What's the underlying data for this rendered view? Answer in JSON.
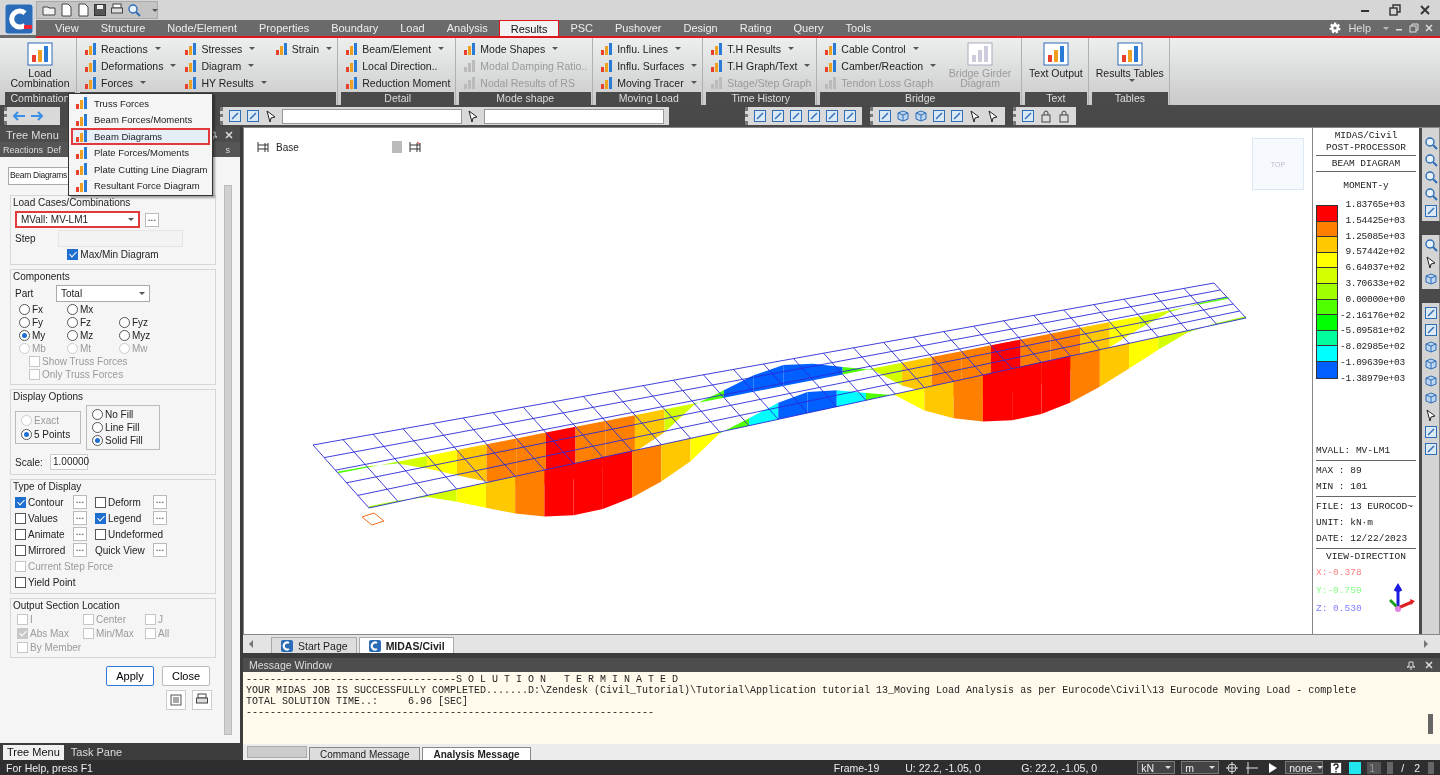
{
  "ribbon": {
    "tabs": [
      {
        "label": "View",
        "selected": false
      },
      {
        "label": "Structure",
        "selected": false
      },
      {
        "label": "Node/Element",
        "selected": false
      },
      {
        "label": "Properties",
        "selected": false
      },
      {
        "label": "Boundary",
        "selected": false
      },
      {
        "label": "Load",
        "selected": false
      },
      {
        "label": "Analysis",
        "selected": false
      },
      {
        "label": "Results",
        "selected": true
      },
      {
        "label": "PSC",
        "selected": false
      },
      {
        "label": "Pushover",
        "selected": false
      },
      {
        "label": "Design",
        "selected": false
      },
      {
        "label": "Rating",
        "selected": false
      },
      {
        "label": "Query",
        "selected": false
      },
      {
        "label": "Tools",
        "selected": false
      }
    ],
    "help": "Help",
    "groups": [
      {
        "label": "Combination",
        "columns": [
          [
            {
              "kind": "large",
              "label": "Load Combination",
              "disabled": false,
              "dropdown": false
            }
          ]
        ]
      },
      {
        "columns": [
          [
            {
              "kind": "small",
              "label": "Reactions",
              "disabled": false,
              "dropdown": true
            },
            {
              "kind": "small",
              "label": "Deformations",
              "disabled": false,
              "dropdown": true
            },
            {
              "kind": "small",
              "label": "Forces",
              "disabled": false,
              "dropdown": true
            }
          ],
          [
            {
              "kind": "small",
              "label": "Stresses",
              "disabled": false,
              "dropdown": true
            },
            {
              "kind": "small",
              "label": "Diagram",
              "disabled": false,
              "dropdown": true
            },
            {
              "kind": "small",
              "label": "HY Results",
              "disabled": false,
              "dropdown": true
            }
          ],
          [
            {
              "kind": "small",
              "label": "Strain",
              "disabled": false,
              "dropdown": true
            }
          ]
        ]
      },
      {
        "label": "Detail",
        "columns": [
          [
            {
              "kind": "small",
              "label": "Beam/Element",
              "disabled": false,
              "dropdown": true
            },
            {
              "kind": "small",
              "label": "Local Direction..",
              "disabled": false,
              "dropdown": false
            },
            {
              "kind": "small",
              "label": "Reduction Moment",
              "disabled": false,
              "dropdown": false
            }
          ]
        ]
      },
      {
        "label": "Mode shape",
        "columns": [
          [
            {
              "kind": "small",
              "label": "Mode Shapes",
              "disabled": false,
              "dropdown": true
            },
            {
              "kind": "small",
              "label": "Modal Damping Ratio..",
              "disabled": true,
              "dropdown": false
            },
            {
              "kind": "small",
              "label": "Nodal Results of RS",
              "disabled": true,
              "dropdown": false
            }
          ]
        ]
      },
      {
        "label": "Moving Load",
        "columns": [
          [
            {
              "kind": "small",
              "label": "Influ. Lines",
              "disabled": false,
              "dropdown": true
            },
            {
              "kind": "small",
              "label": "Influ. Surfaces",
              "disabled": false,
              "dropdown": true
            },
            {
              "kind": "small",
              "label": "Moving Tracer",
              "disabled": false,
              "dropdown": true
            }
          ]
        ]
      },
      {
        "label": "Time History",
        "columns": [
          [
            {
              "kind": "small",
              "label": "T.H Results",
              "disabled": false,
              "dropdown": true
            },
            {
              "kind": "small",
              "label": "T.H Graph/Text",
              "disabled": false,
              "dropdown": true
            },
            {
              "kind": "small",
              "label": "Stage/Step Graph",
              "disabled": true,
              "dropdown": false
            }
          ]
        ]
      },
      {
        "label": "Bridge",
        "columns": [
          [
            {
              "kind": "small",
              "label": "Cable Control",
              "disabled": false,
              "dropdown": true
            },
            {
              "kind": "small",
              "label": "Camber/Reaction",
              "disabled": false,
              "dropdown": true
            },
            {
              "kind": "small",
              "label": "Tendon Loss Graph",
              "disabled": true,
              "dropdown": false
            }
          ],
          [
            {
              "kind": "large",
              "label": "Bridge Girder Diagram",
              "disabled": true,
              "dropdown": false
            }
          ]
        ]
      },
      {
        "label": "Text",
        "columns": [
          [
            {
              "kind": "large",
              "label": "Text Output",
              "disabled": false,
              "dropdown": false
            }
          ]
        ]
      },
      {
        "label": "Tables",
        "columns": [
          [
            {
              "kind": "large",
              "label": "Results Tables",
              "disabled": false,
              "dropdown": true
            }
          ]
        ]
      }
    ]
  },
  "forces_menu": [
    {
      "label": "Truss Forces",
      "selected": false
    },
    {
      "label": "Beam Forces/Moments",
      "selected": false
    },
    {
      "label": "Beam Diagrams",
      "selected": true
    },
    {
      "label": "Plate Forces/Moments",
      "selected": false
    },
    {
      "label": "Plate Cutting Line Diagram",
      "selected": false
    },
    {
      "label": "Resultant Force Diagram",
      "selected": false
    }
  ],
  "panel": {
    "title": "Tree Menu",
    "tabs": [
      "Reactions",
      "Def",
      "s"
    ],
    "function_field": "Beam Diagrams",
    "load_cases": {
      "title": "Load Cases/Combinations",
      "value": "MVall: MV-LM1",
      "more": "...",
      "step_label": "Step",
      "maxmin": {
        "label": "Max/Min Diagram",
        "checked": true
      }
    },
    "components": {
      "title": "Components",
      "part_label": "Part",
      "part_value": "Total",
      "radio_rows": [
        [
          {
            "label": "Fx",
            "selected": false,
            "disabled": false
          },
          {
            "label": "Mx",
            "selected": false,
            "disabled": false
          }
        ],
        [
          {
            "label": "Fy",
            "selected": false,
            "disabled": false
          },
          {
            "label": "Fz",
            "selected": false,
            "disabled": false
          },
          {
            "label": "Fyz",
            "selected": false,
            "disabled": false
          }
        ],
        [
          {
            "label": "My",
            "selected": true,
            "disabled": false
          },
          {
            "label": "Mz",
            "selected": false,
            "disabled": false
          },
          {
            "label": "Myz",
            "selected": false,
            "disabled": false
          }
        ],
        [
          {
            "label": "Mb",
            "selected": false,
            "disabled": true
          },
          {
            "label": "Mt",
            "selected": false,
            "disabled": true
          },
          {
            "label": "Mw",
            "selected": false,
            "disabled": true
          }
        ]
      ],
      "checks": [
        {
          "label": "Show Truss Forces",
          "checked": false,
          "disabled": true
        },
        {
          "label": "Only Truss Forces",
          "checked": false,
          "disabled": true
        }
      ]
    },
    "display_options": {
      "title": "Display Options",
      "points": [
        {
          "label": "Exact",
          "selected": false,
          "disabled": true
        },
        {
          "label": "5 Points",
          "selected": true,
          "disabled": false
        }
      ],
      "fill": [
        {
          "label": "No Fill",
          "selected": false
        },
        {
          "label": "Line Fill",
          "selected": false
        },
        {
          "label": "Solid Fill",
          "selected": true
        }
      ],
      "scale_label": "Scale:",
      "scale_value": "1.00000"
    },
    "type_of_display": {
      "title": "Type of Display",
      "items": [
        {
          "kind": "check",
          "label": "Contour",
          "checked": true,
          "disabled": false,
          "more": "..."
        },
        {
          "kind": "check",
          "label": "Deform",
          "checked": false,
          "disabled": false,
          "more": "..."
        },
        {
          "kind": "check",
          "label": "Values",
          "checked": false,
          "disabled": false,
          "more": "..."
        },
        {
          "kind": "check",
          "label": "Legend",
          "checked": true,
          "disabled": false,
          "more": "..."
        },
        {
          "kind": "check",
          "label": "Animate",
          "checked": false,
          "disabled": false,
          "more": "..."
        },
        {
          "kind": "check",
          "label": "Undeformed",
          "checked": false,
          "disabled": false
        },
        {
          "kind": "check",
          "label": "Mirrored",
          "checked": false,
          "disabled": false,
          "more": "..."
        },
        {
          "kind": "label",
          "label": "Quick View",
          "more": "..."
        },
        {
          "kind": "wide",
          "label": "Current Step Force",
          "checked": false,
          "disabled": true
        },
        {
          "kind": "wide",
          "label": "Yield Point",
          "checked": false,
          "disabled": false
        }
      ]
    },
    "output_section": {
      "title": "Output Section Location",
      "items": [
        {
          "label": "I",
          "checked": false,
          "disabled": true
        },
        {
          "label": "Center",
          "checked": false,
          "disabled": true
        },
        {
          "label": "J",
          "checked": false,
          "disabled": true
        },
        {
          "label": "Abs Max",
          "checked": true,
          "disabled": true
        },
        {
          "label": "Min/Max",
          "checked": false,
          "disabled": true
        },
        {
          "label": "All",
          "checked": false,
          "disabled": true
        },
        {
          "label": "By Member",
          "checked": false,
          "disabled": true
        }
      ]
    },
    "buttons": [
      "Apply",
      "Close"
    ],
    "bottom_tabs": [
      {
        "label": "Tree Menu",
        "selected": true
      },
      {
        "label": "Task Pane",
        "selected": false
      }
    ]
  },
  "viewport": {
    "base_label": "Base",
    "view_cube": "TOP"
  },
  "legend": {
    "header": [
      "MIDAS/Civil",
      "POST-PROCESSOR"
    ],
    "type": "BEAM DIAGRAM",
    "component": "MOMENT-y",
    "values": [
      "1.83765e+03",
      "1.54425e+03",
      "1.25085e+03",
      "9.57442e+02",
      "6.64037e+02",
      "3.70633e+02",
      "0.00000e+00",
      "-2.16176e+02",
      "-5.09581e+02",
      "-8.02985e+02",
      "-1.09639e+03",
      "-1.38979e+03"
    ],
    "bands": [
      {
        "color": "#ff0000"
      },
      {
        "color": "#ff8000"
      },
      {
        "color": "#ffc800"
      },
      {
        "color": "#ffff00"
      },
      {
        "color": "#d4ff00"
      },
      {
        "color": "#a0ff00"
      },
      {
        "color": "#50ff00"
      },
      {
        "color": "#00ff00"
      },
      {
        "color": "#00ff9c"
      },
      {
        "color": "#00ffff"
      },
      {
        "color": "#0060ff"
      }
    ],
    "load_case": "MVALL: MV-LM1",
    "max": "MAX : 89",
    "min": "MIN : 101",
    "file": "FILE: 13 EUROCOD~",
    "unit": "UNIT: kN·m",
    "date": "DATE: 12/22/2023",
    "view_direction_title": "VIEW-DIRECTION",
    "view_direction": [
      {
        "label": "X:-0.378",
        "color": "#ff8080"
      },
      {
        "label": "Y:-0.759",
        "color": "#80ff80"
      },
      {
        "label": "Z: 0.530",
        "color": "#8080ff"
      }
    ]
  },
  "doc_tabs": [
    {
      "label": "Start Page",
      "selected": false
    },
    {
      "label": "MIDAS/Civil",
      "selected": true
    }
  ],
  "message_window": {
    "title": "Message Window",
    "lines": [
      "-----------------------------------S O L U T I O N   T E R M I N A T E D",
      "YOUR MIDAS JOB IS SUCCESSFULLY COMPLETED.......D:\\Zendesk (Civil_Tutorial)\\Tutorial\\Application tutorial 13_Moving Load Analysis as per Eurocode\\Civil\\13 Eurocode Moving Load - complete",
      "TOTAL SOLUTION TIME..:     6.96 [SEC]",
      "--------------------------------------------------------------------"
    ],
    "tabs": [
      {
        "label": "Command Message",
        "selected": false
      },
      {
        "label": "Analysis Message",
        "selected": true
      }
    ]
  },
  "status_bar": {
    "help": "For Help, press F1",
    "frame": "Frame-19",
    "u_coords": "U: 22.2, -1.05, 0",
    "g_coords": "G: 22.2, -1.05, 0",
    "force_unit": "kN",
    "length_unit": "m",
    "option": "none",
    "page": "1",
    "page_sep": "/",
    "page_total": "2"
  }
}
